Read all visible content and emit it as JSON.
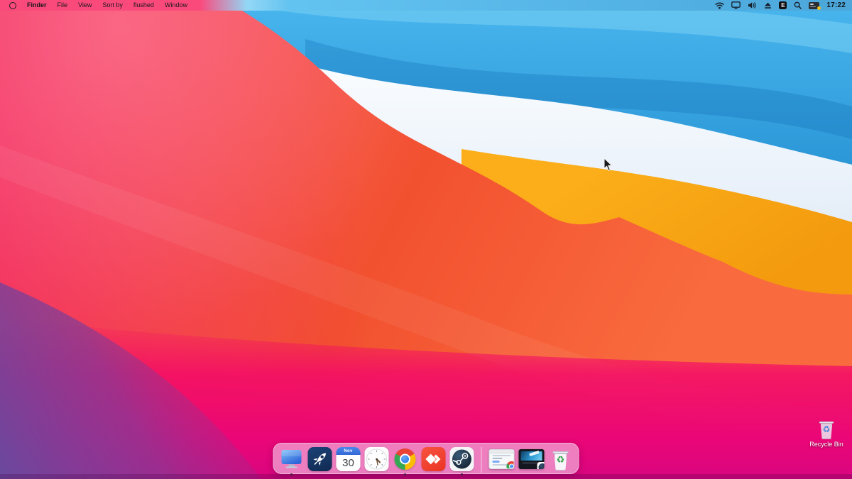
{
  "menubar": {
    "logo_icon": "circle-outline-logo",
    "items": [
      {
        "label": "Finder",
        "bold": true
      },
      {
        "label": "File"
      },
      {
        "label": "View"
      },
      {
        "label": "Sort by"
      },
      {
        "label": "flushed"
      },
      {
        "label": "Window"
      }
    ],
    "status": {
      "icons": [
        "wifi-icon",
        "display-icon",
        "volume-icon",
        "eject-icon",
        "app-e-icon",
        "search-icon",
        "input-method-icon"
      ],
      "app_e_letter": "E",
      "input_method_badge_color": "#f6c21c",
      "clock": "17:22"
    }
  },
  "dock": {
    "apps": [
      {
        "name": "computer",
        "icon": "monitor-icon",
        "running": true
      },
      {
        "name": "launchpad",
        "icon": "rocket-icon",
        "running": false
      },
      {
        "name": "calendar",
        "icon": "calendar-icon",
        "running": false,
        "month": "Nov",
        "day": "30"
      },
      {
        "name": "clock",
        "icon": "analog-clock-icon",
        "running": false
      },
      {
        "name": "chrome",
        "icon": "chrome-icon",
        "running": true
      },
      {
        "name": "anydesk",
        "icon": "anydesk-icon",
        "running": false
      },
      {
        "name": "steam",
        "icon": "steam-icon",
        "running": true
      }
    ],
    "minimized_windows": [
      {
        "name": "chrome-window",
        "badge": "chrome-icon"
      },
      {
        "name": "steam-window",
        "badge": "steam-icon"
      }
    ],
    "trash": {
      "name": "trash",
      "icon": "recycle-bin-icon",
      "symbol": "♻"
    }
  },
  "desktop": {
    "recycle_bin": {
      "label": "Recycle Bin",
      "symbol": "♻"
    }
  },
  "colors": {
    "menubar_left": "#fa4a7c",
    "menubar_right": "#4ca6d9",
    "wallpaper_blue": "#1a84c9",
    "wallpaper_white": "#e9f1fa",
    "wallpaper_orange": "#f8a617",
    "wallpaper_red": "#f2512f",
    "wallpaper_magenta": "#ea0677",
    "wallpaper_purple": "#684a9e",
    "dock_tint": "rgba(248,226,247,0.55)",
    "calendar_header": "#3c72df",
    "anydesk_red": "#ee3a28",
    "steam_navy": "#16202d"
  }
}
